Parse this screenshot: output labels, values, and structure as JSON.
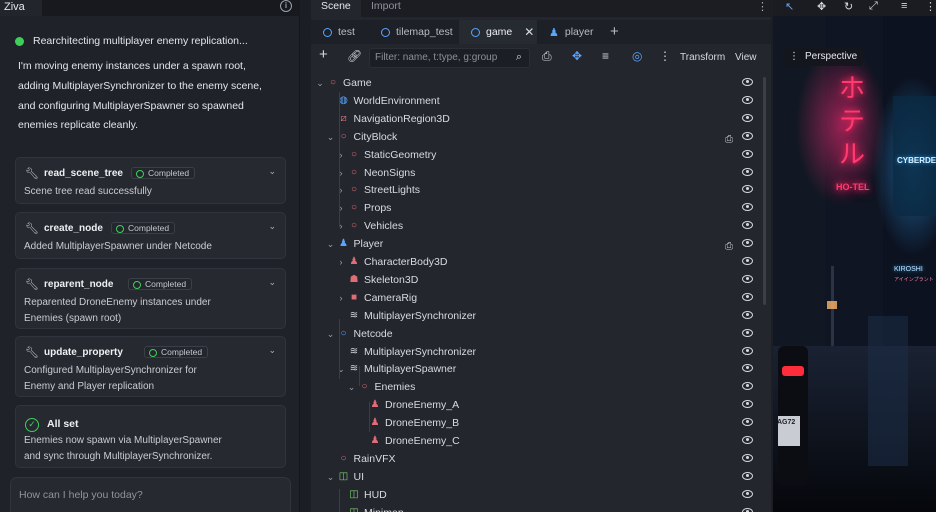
{
  "left": {
    "tab": "Ziva",
    "status": "Rearchitecting multiplayer enemy replication...",
    "intro": "I'm moving enemy instances under a spawn root, adding MultiplayerSynchronizer to the enemy scene, and configuring MultiplayerSpawner so spawned enemies replicate cleanly.",
    "tasks": [
      {
        "name": "read_scene_tree",
        "badge": "Completed",
        "desc": "Scene tree read successfully"
      },
      {
        "name": "create_node",
        "badge": "Completed",
        "desc": "Added MultiplayerSpawner under Netcode"
      },
      {
        "name": "reparent_node",
        "badge": "Completed",
        "desc": "Reparented DroneEnemy instances under Enemies (spawn root)"
      },
      {
        "name": "update_property",
        "badge": "Completed",
        "desc": "Configured MultiplayerSynchronizer for Enemy and Player replication"
      }
    ],
    "done": {
      "title": "All set",
      "desc": "Enemies now spawn via MultiplayerSpawner and sync through MultiplayerSynchronizer."
    },
    "prompt_placeholder": "How can I help you today?"
  },
  "dock": {
    "tabs": [
      "Scene",
      "Import"
    ],
    "scene_tabs": [
      "test",
      "tilemap_test",
      "game",
      "player"
    ],
    "filter_placeholder": "Filter: name, t:type, g:group",
    "transform_label": "Transform",
    "view_label": "View"
  },
  "tree": [
    {
      "label": "Game",
      "icon": "node3d-icon"
    },
    {
      "label": "WorldEnvironment",
      "icon": "world-environment-icon"
    },
    {
      "label": "NavigationRegion3D",
      "icon": "navigation-region-icon"
    },
    {
      "label": "CityBlock",
      "icon": "node3d-icon"
    },
    {
      "label": "StaticGeometry",
      "icon": "node3d-icon"
    },
    {
      "label": "NeonSigns",
      "icon": "node3d-icon"
    },
    {
      "label": "StreetLights",
      "icon": "node3d-icon"
    },
    {
      "label": "Props",
      "icon": "node3d-icon"
    },
    {
      "label": "Vehicles",
      "icon": "node3d-icon"
    },
    {
      "label": "Player",
      "icon": "player-icon"
    },
    {
      "label": "CharacterBody3D",
      "icon": "character-body-icon"
    },
    {
      "label": "Skeleton3D",
      "icon": "skeleton-icon"
    },
    {
      "label": "CameraRig",
      "icon": "camera-icon"
    },
    {
      "label": "MultiplayerSynchronizer",
      "icon": "multiplayer-sync-icon"
    },
    {
      "label": "Netcode",
      "icon": "node-icon"
    },
    {
      "label": "MultiplayerSynchronizer",
      "icon": "multiplayer-sync-icon"
    },
    {
      "label": "MultiplayerSpawner",
      "icon": "multiplayer-spawner-icon"
    },
    {
      "label": "Enemies",
      "icon": "node3d-icon"
    },
    {
      "label": "DroneEnemy_A",
      "icon": "enemy-icon"
    },
    {
      "label": "DroneEnemy_B",
      "icon": "enemy-icon"
    },
    {
      "label": "DroneEnemy_C",
      "icon": "enemy-icon"
    },
    {
      "label": "RainVFX",
      "icon": "node3d-icon"
    },
    {
      "label": "UI",
      "icon": "control-icon"
    },
    {
      "label": "HUD",
      "icon": "control-icon"
    },
    {
      "label": "Minimap",
      "icon": "control-icon"
    }
  ],
  "viewport": {
    "mode_label": "Perspective",
    "sign_jp": "ホテル",
    "sign_en": "HO-TEL",
    "sign_cyber": "CYBERDE",
    "sign_kiroshi": "KIROSHI",
    "sign_kiroshi_sub": "アイインプラント",
    "plate": "AG72"
  },
  "colors": {
    "accent": "#59a5ff",
    "success": "#3ecf5a",
    "node3d": "#e06c75",
    "neon": "#ff3b6e"
  }
}
